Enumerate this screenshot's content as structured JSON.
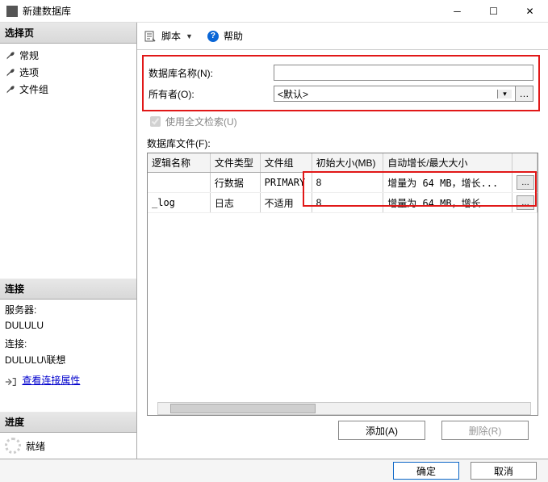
{
  "titlebar": {
    "title": "新建数据库"
  },
  "sidebar": {
    "select_page_header": "选择页",
    "items": [
      {
        "label": "常规"
      },
      {
        "label": "选项"
      },
      {
        "label": "文件组"
      }
    ],
    "connection_header": "连接",
    "server_label": "服务器:",
    "server_value": "DULULU",
    "conn_label": "连接:",
    "conn_value": "DULULU\\联想",
    "view_conn_props": "查看连接属性",
    "progress_header": "进度",
    "ready_text": "就绪"
  },
  "toolbar": {
    "script_label": "脚本",
    "help_label": "帮助"
  },
  "form": {
    "db_name_label": "数据库名称(N):",
    "db_name_value": "",
    "owner_label": "所有者(O):",
    "owner_value": "<默认>",
    "fulltext_label": "使用全文检索(U)",
    "files_label": "数据库文件(F):"
  },
  "table": {
    "headers": {
      "logical_name": "逻辑名称",
      "file_type": "文件类型",
      "filegroup": "文件组",
      "initial_size": "初始大小(MB)",
      "autogrowth": "自动增长/最大大小"
    },
    "rows": [
      {
        "logical_name": "",
        "file_type": "行数据",
        "filegroup": "PRIMARY",
        "initial_size": "8",
        "autogrowth": "增量为 64 MB，增长..."
      },
      {
        "logical_name": "_log",
        "file_type": "日志",
        "filegroup": "不适用",
        "initial_size": "8",
        "autogrowth": "增量为 64 MB，增长..."
      }
    ]
  },
  "buttons": {
    "add": "添加(A)",
    "remove": "删除(R)",
    "ok": "确定",
    "cancel": "取消"
  }
}
